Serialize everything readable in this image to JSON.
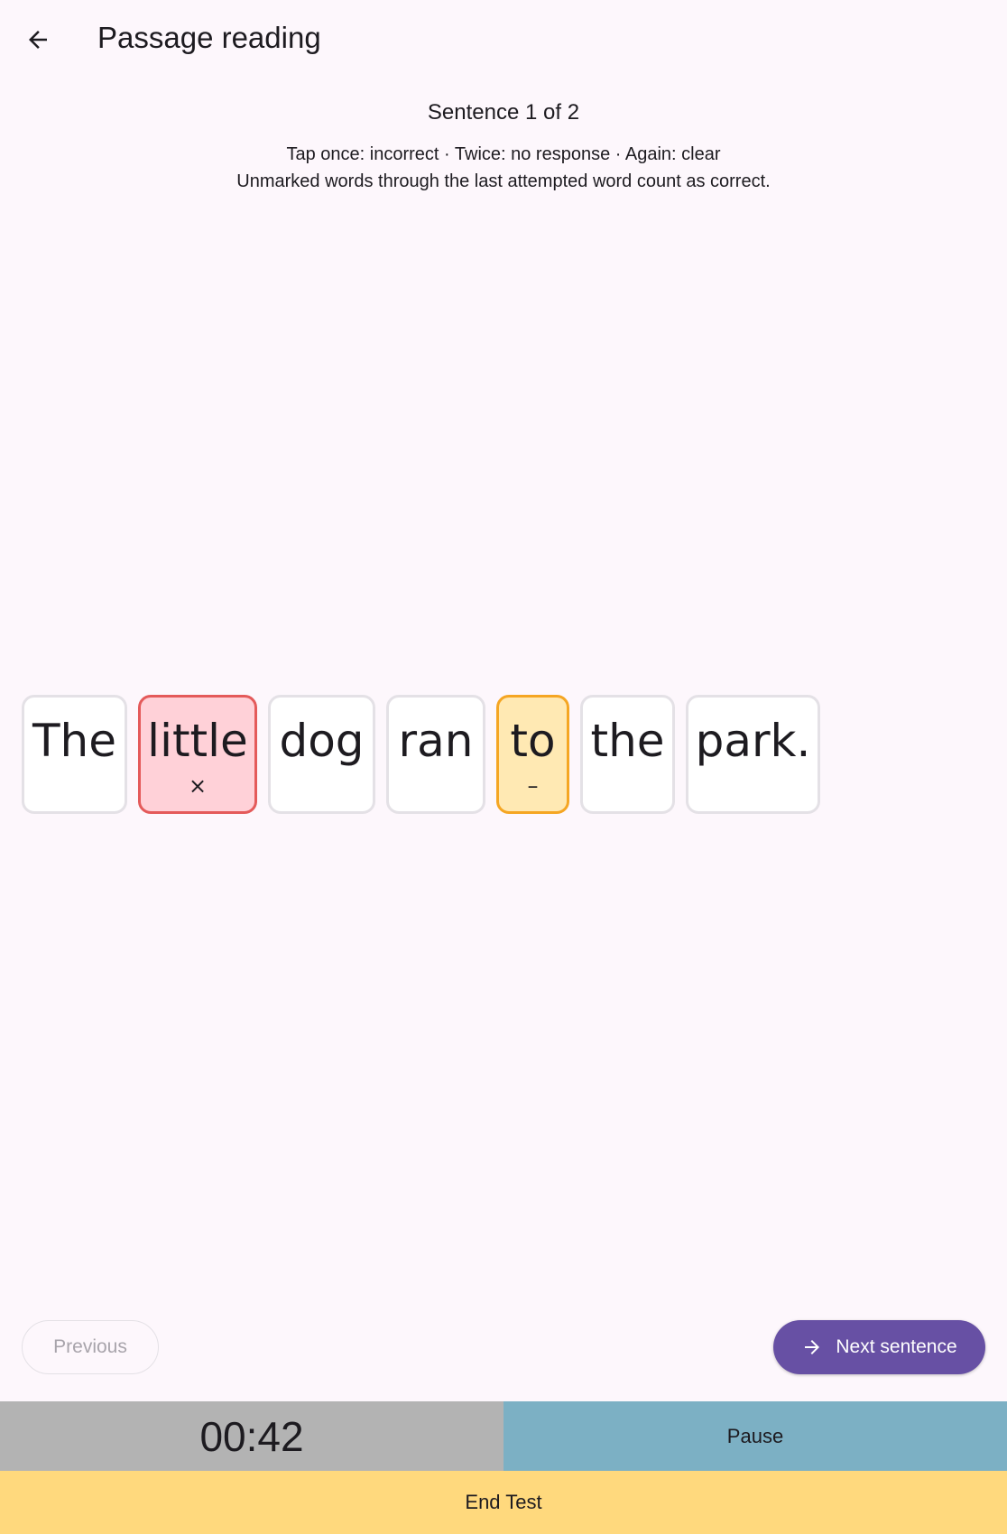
{
  "header": {
    "title": "Passage reading",
    "back_icon": "arrow-left-icon"
  },
  "progress": "Sentence 1 of 2",
  "instructions": {
    "line1": "Tap once: incorrect · Twice: no response · Again: clear",
    "line2": "Unmarked words through the last attempted word count as correct."
  },
  "words": [
    {
      "text": "The",
      "mark": "",
      "state": "unmarked"
    },
    {
      "text": "little",
      "mark": "×",
      "state": "incorrect"
    },
    {
      "text": "dog",
      "mark": "",
      "state": "unmarked"
    },
    {
      "text": "ran",
      "mark": "",
      "state": "unmarked"
    },
    {
      "text": "to",
      "mark": "–",
      "state": "no-response"
    },
    {
      "text": "the",
      "mark": "",
      "state": "unmarked"
    },
    {
      "text": "park.",
      "mark": "",
      "state": "unmarked"
    }
  ],
  "nav": {
    "previous_label": "Previous",
    "next_label": "Next sentence",
    "next_icon": "arrow-right-icon"
  },
  "footer": {
    "timer": "00:42",
    "pause_label": "Pause",
    "end_label": "End Test"
  },
  "colors": {
    "background": "#fdf7fc",
    "accent": "#6750a4",
    "incorrect_fill": "#ffd1d8",
    "incorrect_border": "#e45a5a",
    "noresponse_fill": "#ffe9b3",
    "noresponse_border": "#f5a623",
    "timer_bg": "#b3b3b3",
    "pause_bg": "#7cb0c4",
    "end_bg": "#ffd97d"
  }
}
